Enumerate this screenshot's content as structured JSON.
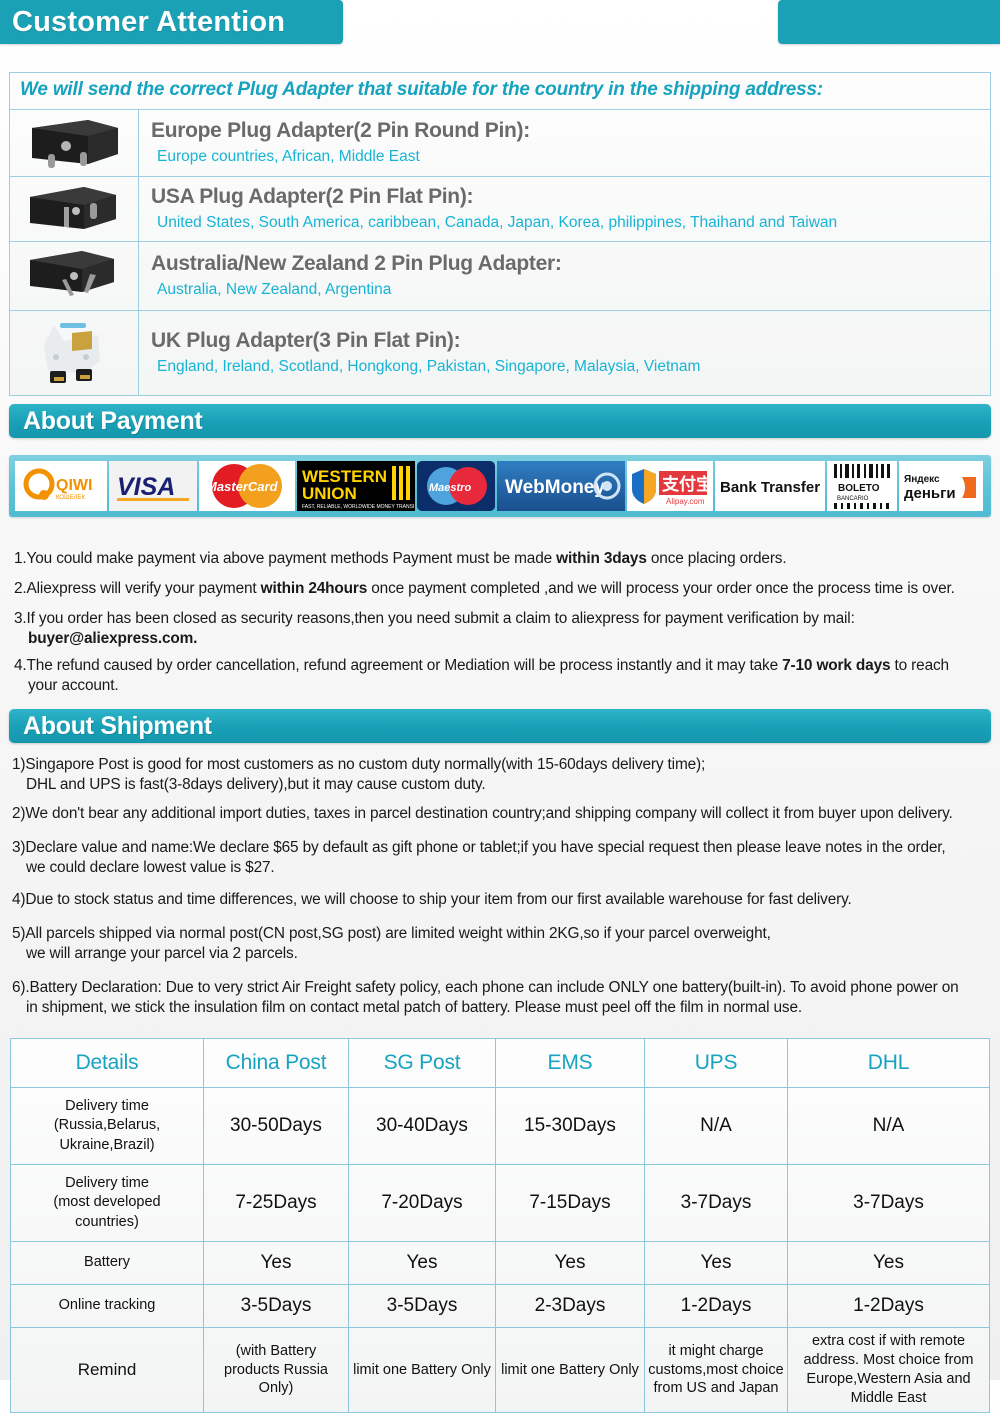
{
  "header": {
    "title": "Customer Attention"
  },
  "plug_section": {
    "intro": "We will send the correct Plug Adapter that suitable for the country in the shipping address:",
    "rows": [
      {
        "icon": "europe-plug-adapter-image",
        "title": "Europe Plug Adapter(2 Pin Round Pin):",
        "countries": "Europe countries, African, Middle East"
      },
      {
        "icon": "usa-plug-adapter-image",
        "title": "USA Plug Adapter(2 Pin Flat Pin):",
        "countries": "United States, South America, caribbean, Canada, Japan, Korea, philippines, Thaihand and Taiwan"
      },
      {
        "icon": "australia-plug-adapter-image",
        "title": "Australia/New Zealand 2 Pin Plug Adapter:",
        "countries": "Australia, New Zealand, Argentina"
      },
      {
        "icon": "uk-plug-adapter-image",
        "title": "UK Plug Adapter(3 Pin Flat Pin):",
        "countries": "England, Ireland, Scotland, Hongkong, Pakistan, Singapore, Malaysia, Vietnam"
      }
    ]
  },
  "payment_section": {
    "banner": "About Payment",
    "logos": [
      {
        "name": "qiwi-logo",
        "label": "QIWI"
      },
      {
        "name": "visa-logo",
        "label": "VISA"
      },
      {
        "name": "mastercard-logo",
        "label": "MasterCard"
      },
      {
        "name": "western-union-logo",
        "label": "WESTERN UNION",
        "tagline": "FAST, RELIABLE, WORLDWIDE MONEY TRANSFER"
      },
      {
        "name": "maestro-logo",
        "label": "Maestro"
      },
      {
        "name": "webmoney-logo",
        "label": "WebMoney"
      },
      {
        "name": "alipay-logo",
        "label": "支付宝",
        "tagline": "Alipay.com"
      },
      {
        "name": "bank-transfer-logo",
        "label": "Bank Transfer"
      },
      {
        "name": "boleto-bancario-logo",
        "label": "BOLETO",
        "tagline": "BANCARIO"
      },
      {
        "name": "yandex-money-logo",
        "label": "деньги",
        "tagline": "Яндекс"
      }
    ],
    "notes": [
      {
        "num": "1.",
        "parts": [
          {
            "t": "You could make payment via above payment methods    Payment must be made ",
            "b": false
          },
          {
            "t": "within 3days",
            "b": true
          },
          {
            "t": " once placing orders.",
            "b": false
          }
        ]
      },
      {
        "num": "2.",
        "parts": [
          {
            "t": "Aliexpress will verify your payment ",
            "b": false
          },
          {
            "t": "within 24hours",
            "b": true
          },
          {
            "t": " once payment completed ,and we will process your order once the process time is over.",
            "b": false
          }
        ]
      },
      {
        "num": "3.",
        "parts": [
          {
            "t": "If you order has been closed as security reasons,then you need submit a claim to aliexpress for payment verification by mail:",
            "b": false
          }
        ],
        "second_line": "buyer@aliexpress.com.",
        "second_line_bold": true
      },
      {
        "num": "4.",
        "parts": [
          {
            "t": "The refund caused by order cancellation, refund agreement or Mediation will be process instantly and it may take ",
            "b": false
          },
          {
            "t": "7-10 work days",
            "b": true
          },
          {
            "t": " to reach",
            "b": false
          }
        ],
        "second_line": "your account.",
        "second_line_bold": false
      }
    ]
  },
  "shipment_section": {
    "banner": "About Shipment",
    "notes": [
      {
        "num": "1)",
        "line1": "Singapore Post is good for most customers as no custom duty normally(with 15-60days delivery time);",
        "line2": "DHL and UPS is fast(3-8days delivery),but it may cause custom duty."
      },
      {
        "num": "2)",
        "line1": "We don't bear any additional import duties, taxes in parcel destination country;and shipping company will collect it from buyer upon delivery.",
        "line2": ""
      },
      {
        "num": "3)",
        "line1": "Declare value and name:We declare $65 by default as gift phone or tablet;if you have special request then please leave notes in the order,",
        "line2": "we could declare lowest value is $27."
      },
      {
        "num": "4)",
        "line1": "Due to stock status and time differences, we will choose to ship your item from our first available warehouse for fast delivery.",
        "line2": ""
      },
      {
        "num": "5)",
        "line1": "All parcels shipped via normal post(CN post,SG post) are limited weight within 2KG,so if your parcel overweight,",
        "line2": "we will arrange your parcel via 2 parcels."
      },
      {
        "num": "6).",
        "line1": "Battery Declaration: Due to very strict Air Freight safety policy, each phone can include ONLY one battery(built-in). To avoid phone power on",
        "line2": "in shipment, we stick the insulation film on contact metal patch of battery. Please must peel off the film in normal use."
      }
    ]
  },
  "shipping_table": {
    "headers": [
      "Details",
      "China Post",
      "SG Post",
      "EMS",
      "UPS",
      "DHL"
    ],
    "rows": [
      {
        "label": "Delivery time\n(Russia,Belarus,\nUkraine,Brazil)",
        "cells": [
          "30-50Days",
          "30-40Days",
          "15-30Days",
          "N/A",
          "N/A"
        ]
      },
      {
        "label": "Delivery time\n(most developed\ncountries)",
        "cells": [
          "7-25Days",
          "7-20Days",
          "7-15Days",
          "3-7Days",
          "3-7Days"
        ]
      },
      {
        "label": "Battery",
        "cells": [
          "Yes",
          "Yes",
          "Yes",
          "Yes",
          "Yes"
        ]
      },
      {
        "label": "Online tracking",
        "cells": [
          "3-5Days",
          "3-5Days",
          "2-3Days",
          "1-2Days",
          "1-2Days"
        ]
      },
      {
        "label": "Remind",
        "cells": [
          "(with Battery products Russia Only)",
          "limit one Battery Only",
          "limit one Battery Only",
          "it might charge customs,most choice from US and Japan",
          "extra cost if with remote address. Most choice from Europe,Western Asia and Middle East"
        ],
        "small": true
      }
    ]
  },
  "colors": {
    "teal": "#1ba1b5",
    "banner_teal": "#18a0b6",
    "cyan_text": "#17b4d4",
    "title_gray": "#6a6a6a",
    "table_border": "#8cc7dd"
  }
}
